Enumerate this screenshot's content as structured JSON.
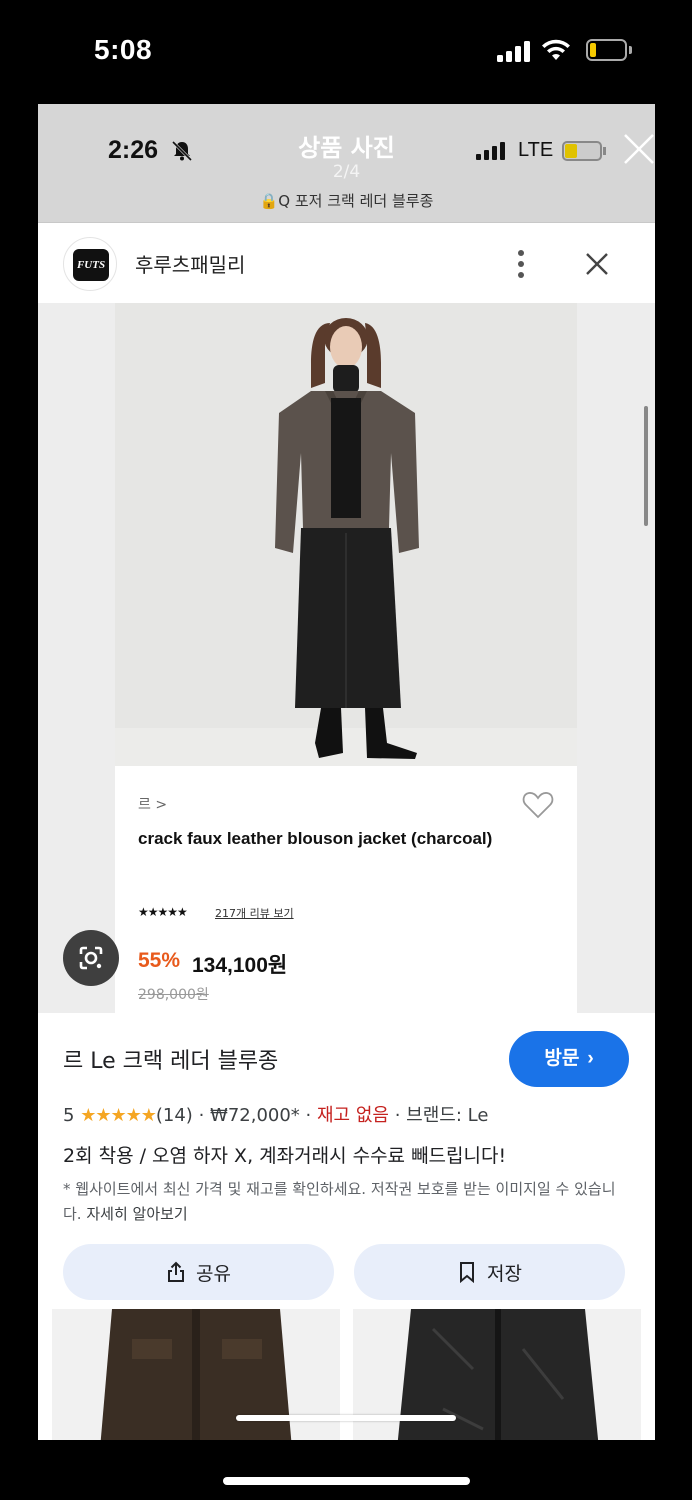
{
  "outer_status": {
    "time": "5:08"
  },
  "inner_status": {
    "time": "2:26",
    "network": "LTE"
  },
  "viewer_header": {
    "title": "상품 사진",
    "counter": "2/4",
    "query": "🔒Q 포저 크랙 레더 블루종"
  },
  "shop": {
    "logo_text": "FUTS",
    "name": "후루츠패밀리"
  },
  "product_card": {
    "brand_crumb": "르 >",
    "name": "crack faux leather blouson jacket (charcoal)",
    "rating_stars": "★★★★★",
    "review_link": "217개 리뷰 보기",
    "discount": "55%",
    "sale_price": "134,100원",
    "original_price": "298,000원"
  },
  "result": {
    "title": "르 Le 크랙 레더 블루종",
    "visit_label": "방문",
    "rating_value": "5",
    "rating_stars": "★★★★★",
    "rating_count": "(14)",
    "price": "₩72,000*",
    "stock": "재고 없음",
    "brand": "브랜드: Le",
    "description": "2회 착용 / 오염 하자 X, 계좌거래시 수수료 빼드립니다!",
    "notice": "* 웹사이트에서 최신 가격 및 재고를 확인하세요. 저작권 보호를 받는 이미지일 수 있습니다.",
    "learn_more": "자세히 알아보기",
    "share_label": "공유",
    "save_label": "저장"
  },
  "colors": {
    "accent_blue": "#1a73e8",
    "discount_orange": "#e85a1c",
    "stock_red": "#c5221f",
    "star_gold": "#f5a623"
  }
}
